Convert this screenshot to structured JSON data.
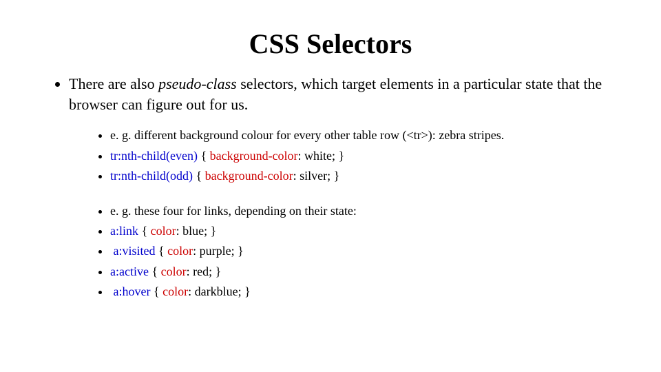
{
  "title": "CSS Selectors",
  "intro": {
    "pre": "There are also ",
    "pseudo": "pseudo-class",
    "post": " selectors, which target elements in a particular state that the browser can figure out for us."
  },
  "group1": {
    "a": "e. g. different background colour for every other table row (<tr>): zebra stripes.",
    "b_sel": "tr:nth-child(even)",
    "b_mid": " { ",
    "b_prop": "background-color",
    "b_end": ": white; }",
    "c_sel": "tr:nth-child(odd)",
    "c_mid": " { ",
    "c_prop": "background-color",
    "c_end": ": silver; }"
  },
  "group2": {
    "a": "e. g. these four for links, depending on their state:",
    "b_sel": "a:link",
    "b_mid": " { ",
    "b_prop": "color",
    "b_end": ": blue; }",
    "c_pre": " ",
    "c_sel": "a:visited",
    "c_mid": " { ",
    "c_prop": "color",
    "c_end": ": purple; }",
    "d_sel": "a:active",
    "d_mid": " { ",
    "d_prop": "color",
    "d_end": ": red; }",
    "e_pre": " ",
    "e_sel": "a:hover",
    "e_mid": " { ",
    "e_prop": "color",
    "e_end": ": darkblue; }"
  }
}
